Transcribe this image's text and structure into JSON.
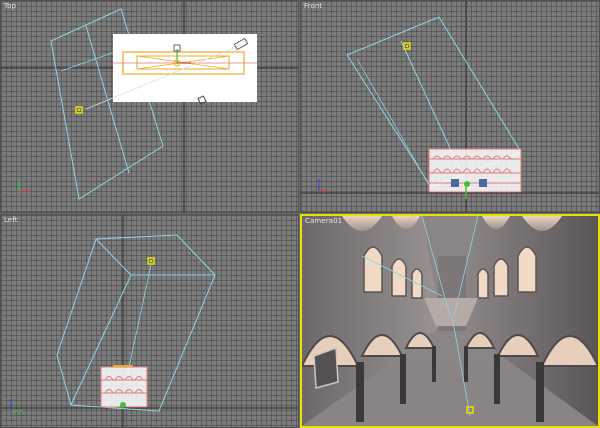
{
  "viewports": {
    "top": {
      "label": "Top"
    },
    "front": {
      "label": "Front"
    },
    "left": {
      "label": "Left"
    },
    "camera": {
      "label": "Camera01"
    }
  },
  "active_viewport": "camera",
  "colors": {
    "grid_major": "#2a2a2a",
    "wireframe": "#8fd3e6",
    "selection": "#f0a820",
    "geometry": "#e07a7a",
    "active_border": "#e8e200",
    "axis_x": "#d04040",
    "axis_y": "#3cc03c",
    "axis_z": "#4040d0"
  }
}
